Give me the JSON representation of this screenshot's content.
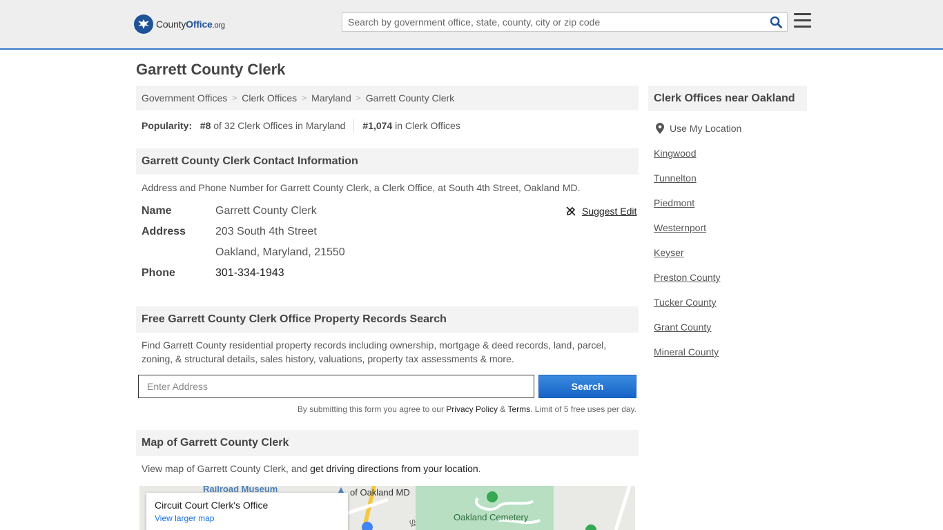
{
  "header": {
    "logo": {
      "prefix": "County",
      "brand": "Office",
      "suffix": ".org"
    },
    "search_placeholder": "Search by government office, state, county, city or zip code"
  },
  "page": {
    "title": "Garrett County Clerk"
  },
  "breadcrumb": [
    "Government Offices",
    "Clerk Offices",
    "Maryland",
    "Garrett County Clerk"
  ],
  "popularity": {
    "label": "Popularity:",
    "rank1": "#8",
    "rank1_text": "of 32 Clerk Offices in Maryland",
    "rank2": "#1,074",
    "rank2_text": "in Clerk Offices"
  },
  "contact": {
    "heading": "Garrett County Clerk Contact Information",
    "description": "Address and Phone Number for Garrett County Clerk, a Clerk Office, at South 4th Street, Oakland MD.",
    "suggest_edit": "Suggest Edit",
    "name_label": "Name",
    "name": "Garrett County Clerk",
    "address_label": "Address",
    "address_line1": "203 South 4th Street",
    "address_line2": "Oakland, Maryland, 21550",
    "phone_label": "Phone",
    "phone": "301-334-1943"
  },
  "property": {
    "heading": "Free Garrett County Clerk Office Property Records Search",
    "description_line1": "Find Garrett County residential property records including ownership, mortgage & deed records, land, parcel,",
    "description_line2": "zoning, & structural details, sales history, valuations, property tax assessments & more.",
    "input_placeholder": "Enter Address",
    "search_label": "Search",
    "disclaimer_prefix": "By submitting this form you agree to our",
    "privacy": "Privacy Policy",
    "amp": "&",
    "terms": "Terms",
    "disclaimer_suffix": ". Limit of 5 free uses per day."
  },
  "map_section": {
    "heading": "Map of Garrett County Clerk",
    "text_prefix": "View map of Garrett County Clerk, and",
    "directions_link": "get driving directions from your location",
    "text_suffix": ".",
    "card_title": "Circuit Court Clerk's Office",
    "card_link": "View larger map",
    "labels": [
      "Railroad Museum",
      "of Oakland MD",
      "Oakland Cemetery",
      "St"
    ]
  },
  "sidebar": {
    "heading": "Clerk Offices near Oakland",
    "use_location": "Use My Location",
    "links": [
      "Kingwood",
      "Tunnelton",
      "Piedmont",
      "Westernport",
      "Keyser",
      "Preston County",
      "Tucker County",
      "Grant County",
      "Mineral County"
    ]
  },
  "colors": {
    "accent": "#1f5296",
    "header_border": "#3a7bc8",
    "button": "#1763c6"
  }
}
